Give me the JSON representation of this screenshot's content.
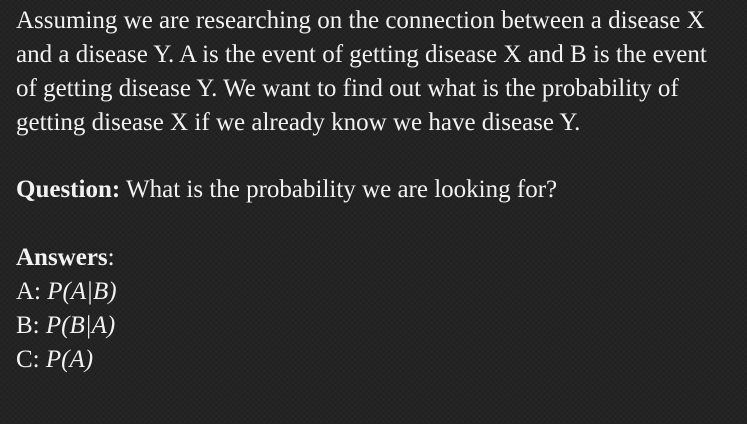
{
  "problem": {
    "text": "Assuming we are researching on the connection between a disease X and a disease Y. A is the event of getting disease X and B is the event of getting disease Y. We want to find out what is the probability of getting disease X if we already know we have disease Y."
  },
  "question": {
    "label": "Question:",
    "text": "What is the probability we are looking for?"
  },
  "answers": {
    "heading": "Answers",
    "heading_suffix": ":",
    "options": [
      {
        "letter": "A:",
        "expression": "P(A|B)"
      },
      {
        "letter": "B:",
        "expression": "P(B|A)"
      },
      {
        "letter": "C:",
        "expression": "P(A)"
      }
    ]
  }
}
